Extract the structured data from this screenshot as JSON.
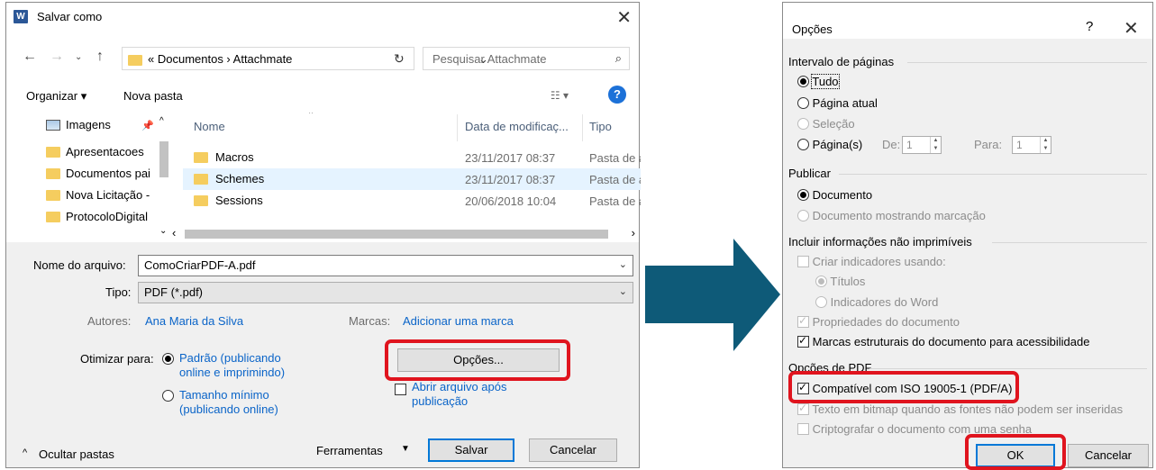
{
  "save_dialog": {
    "title": "Salvar como",
    "breadcrumb": "«  Documentos  ›  Attachmate",
    "search_placeholder": "Pesquisar Attachmate",
    "toolbar": {
      "organize": "Organizar ▾",
      "new_folder": "Nova pasta"
    },
    "nav_items": [
      "Imagens",
      "Apresentacoes",
      "Documentos pai",
      "Nova Licitação -",
      "ProtocoloDigital"
    ],
    "columns": {
      "name": "Nome",
      "date": "Data de modificaç...",
      "type": "Tipo"
    },
    "files": [
      {
        "name": "Macros",
        "date": "23/11/2017 08:37",
        "type": "Pasta de a"
      },
      {
        "name": "Schemes",
        "date": "23/11/2017 08:37",
        "type": "Pasta de a"
      },
      {
        "name": "Sessions",
        "date": "20/06/2018 10:04",
        "type": "Pasta de a"
      }
    ],
    "filename_label": "Nome do arquivo:",
    "filename_value": "ComoCriarPDF-A.pdf",
    "type_label": "Tipo:",
    "type_value": "PDF (*.pdf)",
    "authors_label": "Autores:",
    "authors_value": "Ana Maria da Silva",
    "tags_label": "Marcas:",
    "tags_value": "Adicionar uma marca",
    "optimize_label": "Otimizar para:",
    "optimize_standard_1": "Padrão (publicando",
    "optimize_standard_2": "online e imprimindo)",
    "optimize_min_1": "Tamanho mínimo",
    "optimize_min_2": "(publicando online)",
    "options_button": "Opções...",
    "open_after_1": "Abrir arquivo após",
    "open_after_2": "publicação",
    "hide_folders": "Ocultar pastas",
    "tools": "Ferramentas",
    "save": "Salvar",
    "cancel": "Cancelar"
  },
  "options_dialog": {
    "title": "Opções",
    "help": "?",
    "close": "✕",
    "page_range": {
      "label": "Intervalo de páginas",
      "all": "Tudo",
      "current": "Página atual",
      "selection": "Seleção",
      "pages": "Página(s)",
      "from_label": "De:",
      "from_value": "1",
      "to_label": "Para:",
      "to_value": "1"
    },
    "publish": {
      "label": "Publicar",
      "document": "Documento",
      "document_markup": "Documento mostrando marcação"
    },
    "non_printing": {
      "label": "Incluir informações não imprimíveis",
      "create_bookmarks": "Criar indicadores usando:",
      "headings": "Títulos",
      "word_bookmarks": "Indicadores do Word",
      "doc_properties": "Propriedades do documento",
      "structure_tags": "Marcas estruturais do documento para acessibilidade"
    },
    "pdf_options": {
      "label": "Opções de PDF",
      "iso": "Compatível com ISO 19005-1 (PDF/A)",
      "bitmap": "Texto em bitmap quando as fontes não podem ser inseridas",
      "encrypt": "Criptografar o documento com uma senha"
    },
    "ok": "OK",
    "cancel": "Cancelar"
  },
  "colors": {
    "highlight": "#e0141e",
    "arrow": "#0e5a78",
    "link": "#0a64c8"
  }
}
